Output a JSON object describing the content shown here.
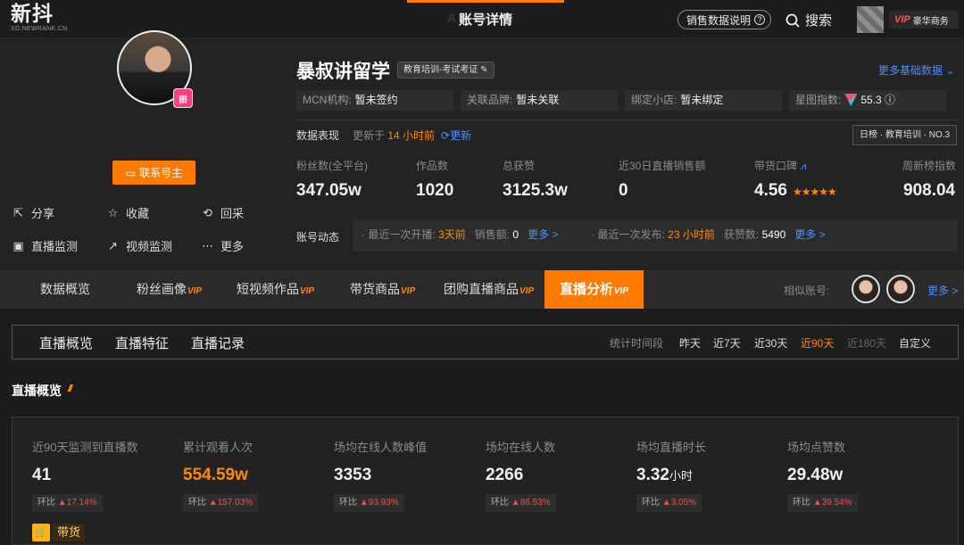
{
  "header": {
    "logo_cn": "新抖",
    "logo_en": "XD.NEWRANK.CN",
    "page_title_ghost": "A    N T",
    "page_title": "账号详情",
    "sales_explain": "销售数据说明",
    "search_label": "搜索",
    "vip_label": "VIP",
    "vip_tier": "豪华商务"
  },
  "profile": {
    "name": "暴叔讲留学",
    "category_tag": "教育培训-考试考证",
    "more_basic": "更多基础数据",
    "contact_button": "联系号主",
    "actions": {
      "share": "分享",
      "collect": "收藏",
      "backfill": "回采",
      "live_monitor": "直播监测",
      "video_monitor": "视频监测",
      "more": "更多"
    },
    "info": {
      "mcn_label": "MCN机构:",
      "mcn_value": "暂未签约",
      "brand_label": "关联品牌:",
      "brand_value": "暂未关联",
      "shop_label": "绑定小店:",
      "shop_value": "暂未绑定",
      "star_label": "星图指数:",
      "star_value": "55.3"
    },
    "performance": {
      "label": "数据表现",
      "updated_prefix": "更新于",
      "updated_value": "14 小时前",
      "refresh": "更新",
      "rank_tag": "日榜 · 教育培训 · NO.3"
    },
    "stats": {
      "fans_label": "粉丝数(全平台)",
      "fans_value": "347.05w",
      "works_label": "作品数",
      "works_value": "1020",
      "likes_label": "总获赞",
      "likes_value": "3125.3w",
      "live_sales_label": "近30日直播销售额",
      "live_sales_value": "0",
      "reputation_label": "带货口碑",
      "reputation_value": "4.56",
      "reputation_stars": "★★★★★",
      "weekly_label": "周新榜指数",
      "weekly_value": "908.04"
    },
    "dynamics": {
      "label": "账号动态",
      "last_live_prefix": "最近一次开播:",
      "last_live_value": "3天前",
      "sales_prefix": "销售额:",
      "sales_value": "0",
      "more1": "更多 >",
      "last_post_prefix": "最近一次发布:",
      "last_post_value": "23 小时前",
      "liked_prefix": "获赞数:",
      "liked_value": "5490",
      "more2": "更多 >"
    }
  },
  "tabs": {
    "overview": "数据概览",
    "fans": "粉丝画像",
    "short_video": "短视频作品",
    "goods": "带货商品",
    "group_buy": "团购直播商品",
    "live": "直播分析",
    "vip": "VIP",
    "similar_label": "相似账号:",
    "similar_more": "更多 >"
  },
  "subnav": {
    "overview": "直播概览",
    "features": "直播特征",
    "records": "直播记录",
    "period_label": "统计时间段",
    "periods": [
      "昨天",
      "近7天",
      "近30天",
      "近90天",
      "近180天",
      "自定义"
    ]
  },
  "overview": {
    "section_title": "直播概览",
    "metrics": [
      {
        "label": "近90天监测到直播数",
        "value": "41",
        "unit": "",
        "change_prefix": "环比",
        "change": "17.14%"
      },
      {
        "label": "累计观看人次",
        "value": "554.59w",
        "unit": "",
        "change_prefix": "环比",
        "change": "157.03%"
      },
      {
        "label": "场均在线人数峰值",
        "value": "3353",
        "unit": "",
        "change_prefix": "环比",
        "change": "93.93%"
      },
      {
        "label": "场均在线人数",
        "value": "2266",
        "unit": "",
        "change_prefix": "环比",
        "change": "86.53%"
      },
      {
        "label": "场均直播时长",
        "value": "3.32",
        "unit": "小时",
        "change_prefix": "环比",
        "change": "3.05%"
      },
      {
        "label": "场均点赞数",
        "value": "29.48w",
        "unit": "",
        "change_prefix": "环比",
        "change": "39.54%"
      }
    ],
    "goods_label": "带货"
  },
  "colors": {
    "accent": "#ff7a00",
    "link": "#4a90ff",
    "up": "#ff4646"
  }
}
